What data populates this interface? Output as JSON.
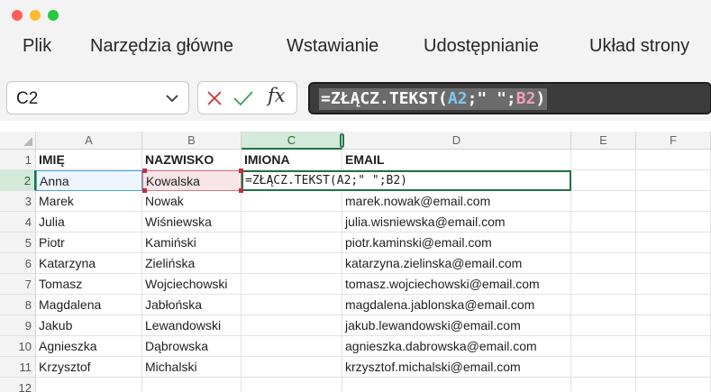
{
  "ribbon": {
    "menu": [
      "Plik",
      "Narzędzia główne",
      "Wstawianie",
      "Udostępnianie",
      "Układ strony"
    ]
  },
  "formula": {
    "namebox": "C2",
    "fx_label": "fx",
    "parts": [
      "=ZŁĄCZ.TEKST(",
      "A2",
      ";\" \";",
      "B2",
      ")"
    ]
  },
  "grid": {
    "columns": [
      "A",
      "B",
      "C",
      "D",
      "E",
      "F"
    ],
    "selected_column": "C",
    "selected_row": "2",
    "rows": [
      {
        "n": "1",
        "a": "IMIĘ",
        "b": "NAZWISKO",
        "c": "IMIONA",
        "d": "EMAIL"
      },
      {
        "n": "2",
        "a": "Anna",
        "b": "Kowalska",
        "c": "=ZŁĄCZ.TEKST(A2;\" \";B2)",
        "d": ""
      },
      {
        "n": "3",
        "a": "Marek",
        "b": "Nowak",
        "c": "",
        "d": "marek.nowak@email.com"
      },
      {
        "n": "4",
        "a": "Julia",
        "b": "Wiśniewska",
        "c": "",
        "d": "julia.wisniewska@email.com"
      },
      {
        "n": "5",
        "a": "Piotr",
        "b": "Kamiński",
        "c": "",
        "d": "piotr.kaminski@email.com"
      },
      {
        "n": "6",
        "a": "Katarzyna",
        "b": "Zielińska",
        "c": "",
        "d": "katarzyna.zielinska@email.com"
      },
      {
        "n": "7",
        "a": "Tomasz",
        "b": "Wojciechowski",
        "c": "",
        "d": "tomasz.wojciechowski@email.com"
      },
      {
        "n": "8",
        "a": "Magdalena",
        "b": "Jabłońska",
        "c": "",
        "d": "magdalena.jablonska@email.com"
      },
      {
        "n": "9",
        "a": "Jakub",
        "b": "Lewandowski",
        "c": "",
        "d": "jakub.lewandowski@email.com"
      },
      {
        "n": "10",
        "a": "Agnieszka",
        "b": "Dąbrowska",
        "c": "",
        "d": "agnieszka.dabrowska@email.com"
      },
      {
        "n": "11",
        "a": "Krzysztof",
        "b": "Michalski",
        "c": "",
        "d": "krzysztof.michalski@email.com"
      },
      {
        "n": "12",
        "a": "",
        "b": "",
        "c": "",
        "d": ""
      }
    ]
  },
  "colors": {
    "selection_green": "#217346",
    "ref_a": "#7ec8f3",
    "ref_b": "#f0a0c0"
  }
}
